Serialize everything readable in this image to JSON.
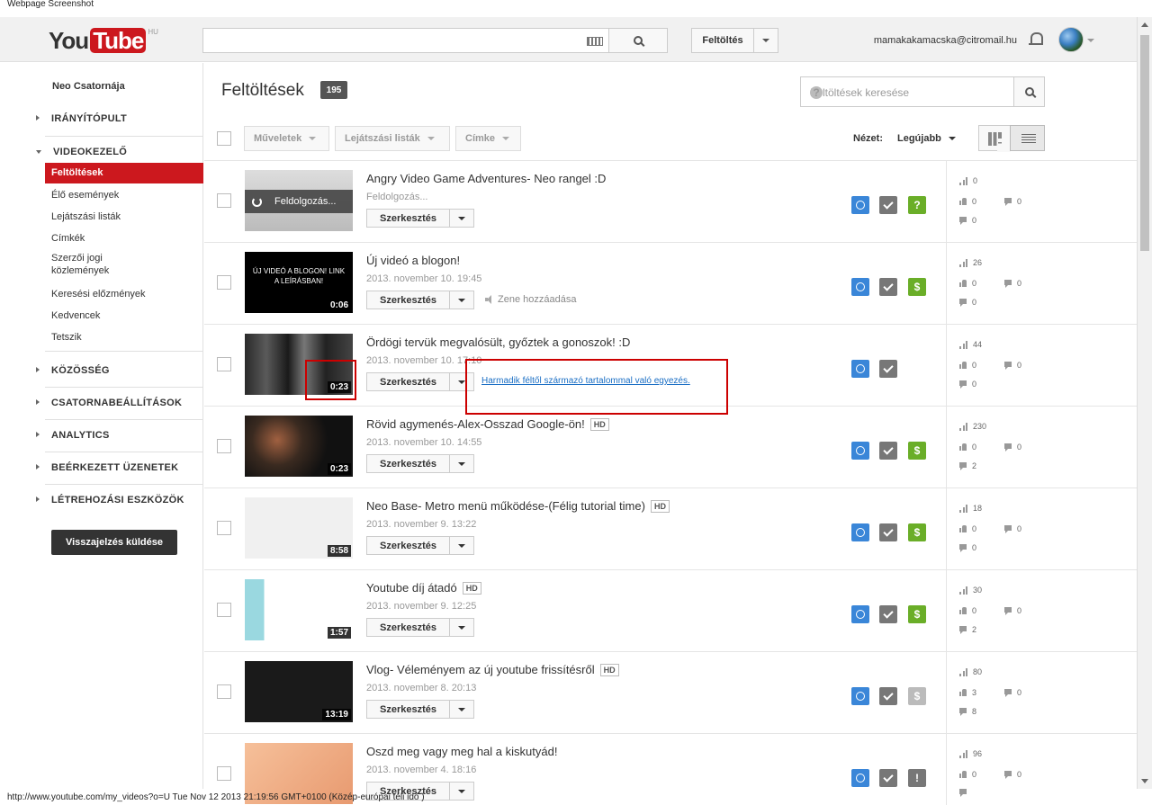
{
  "caption": "Webpage Screenshot",
  "masthead": {
    "logo_you": "You",
    "logo_tube": "Tube",
    "logo_country": "HU",
    "upload_label": "Feltöltés",
    "email": "mamakakamacska@citromail.hu"
  },
  "sidebar": {
    "owner": "Neo Csatornája",
    "sections": {
      "dashboard": "IRÁNYÍTÓPULT",
      "video_manager": "VIDEOKEZELŐ",
      "community": "KÖZÖSSÉG",
      "channel_settings": "CSATORNABEÁLLÍTÁSOK",
      "analytics": "ANALYTICS",
      "inbox": "BEÉRKEZETT ÜZENETEK",
      "creation_tools": "LÉTREHOZÁSI ESZKÖZÖK"
    },
    "items": {
      "uploads": "Feltöltések",
      "live": "Élő események",
      "playlists": "Lejátszási listák",
      "tags": "Címkék",
      "copyright_1": "Szerzői jogi",
      "copyright_2": "közlemények",
      "search_history": "Keresési előzmények",
      "favorites": "Kedvencek",
      "likes": "Tetszik"
    },
    "feedback": "Visszajelzés küldése"
  },
  "main": {
    "title": "Feltöltések",
    "count": "195",
    "search_placeholder": "Feltöltések keresése",
    "help_glyph": "?",
    "actions": "Műveletek",
    "playlists": "Lejátszási listák",
    "tag": "Címke",
    "view_label": "Nézet:",
    "view_sort": "Legújabb"
  },
  "videos": [
    {
      "title": "Angry Video Game Adventures- Neo rangel :D",
      "date": "Feldolgozás...",
      "processing": "Feldolgozás...",
      "views": "0",
      "likes": "0",
      "dislikes": "0",
      "comments": "0",
      "third": "?",
      "third_color": "#6aae28"
    },
    {
      "title": "Új videó a blogon!",
      "date": "2013. november 10. 19:45",
      "duration": "0:06",
      "thumb_text": "ÚJ VIDEÓ A BLOGON! LINK A LEÍRÁSBAN!",
      "extra": "Zene hozzáadása",
      "views": "26",
      "likes": "0",
      "dislikes": "0",
      "comments": "0",
      "third": "$",
      "third_color": "#6aae28"
    },
    {
      "title": "Ördögi tervük megvalósült, győztek a gonoszok! :D",
      "date": "2013. november 10. 17:10",
      "duration": "0:23",
      "third_party": "Harmadik féltől származó tartalommal való egyezés.",
      "views": "44",
      "likes": "0",
      "dislikes": "0",
      "comments": "0"
    },
    {
      "title": "Rövid agymenés-Alex-Osszad Google-ön!",
      "hd": "HD",
      "date": "2013. november 10. 14:55",
      "duration": "0:23",
      "views": "230",
      "likes": "0",
      "dislikes": "0",
      "comments": "2",
      "third": "$",
      "third_color": "#6aae28"
    },
    {
      "title": "Neo Base- Metro menü működése-(Félig tutorial time)",
      "hd": "HD",
      "date": "2013. november 9. 13:22",
      "duration": "8:58",
      "views": "18",
      "likes": "0",
      "dislikes": "0",
      "comments": "0",
      "third": "$",
      "third_color": "#6aae28"
    },
    {
      "title": "Youtube díj átadó",
      "hd": "HD",
      "date": "2013. november 9. 12:25",
      "duration": "1:57",
      "views": "30",
      "likes": "0",
      "dislikes": "0",
      "comments": "2",
      "third": "$",
      "third_color": "#6aae28"
    },
    {
      "title": "Vlog- Véleményem az új youtube frissítésről",
      "hd": "HD",
      "date": "2013. november 8. 20:13",
      "duration": "13:19",
      "views": "80",
      "likes": "3",
      "dislikes": "0",
      "comments": "8",
      "third": "$",
      "third_color": "#bbbbbb"
    },
    {
      "title": "Oszd meg vagy meg hal a kiskutyád!",
      "date": "2013. november 4. 18:16",
      "views": "96",
      "likes": "0",
      "dislikes": "0",
      "comments": "",
      "third": "!",
      "third_color": "#777777"
    }
  ],
  "edit_label": "Szerkesztés",
  "footer": "http://www.youtube.com/my_videos?o=U Tue Nov 12 2013 21:19:56 GMT+0100 (Közép-európai téli idő )"
}
